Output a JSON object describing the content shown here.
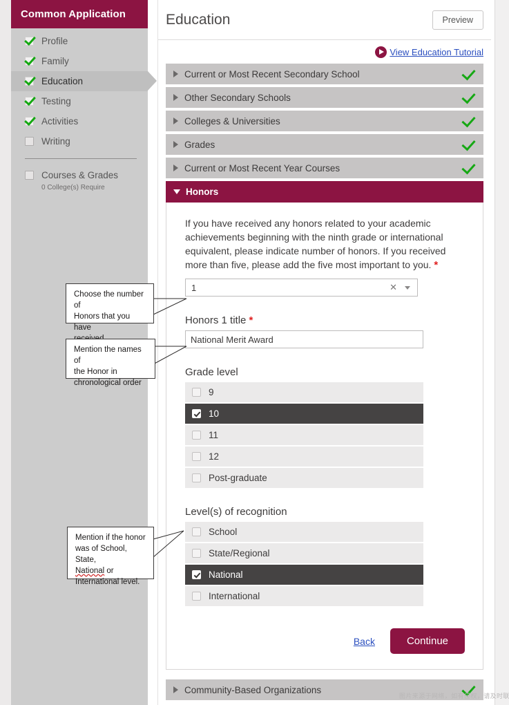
{
  "sidebar": {
    "title": "Common Application",
    "items": [
      {
        "label": "Profile",
        "checked": true,
        "active": false
      },
      {
        "label": "Family",
        "checked": true,
        "active": false
      },
      {
        "label": "Education",
        "checked": true,
        "active": true
      },
      {
        "label": "Testing",
        "checked": true,
        "active": false
      },
      {
        "label": "Activities",
        "checked": true,
        "active": false
      },
      {
        "label": "Writing",
        "checked": false,
        "active": false
      }
    ],
    "courses": {
      "label": "Courses & Grades",
      "sublabel": "0 College(s) Require",
      "checked": false
    }
  },
  "header": {
    "title": "Education",
    "preview_label": "Preview",
    "tutorial_link": "View Education Tutorial",
    "play_icon": "play-circle-icon"
  },
  "accordion": {
    "sections": [
      {
        "label": "Current or Most Recent Secondary School",
        "open": false,
        "complete": true
      },
      {
        "label": "Other Secondary Schools",
        "open": false,
        "complete": true
      },
      {
        "label": "Colleges & Universities",
        "open": false,
        "complete": true
      },
      {
        "label": "Grades",
        "open": false,
        "complete": true
      },
      {
        "label": "Current or Most Recent Year Courses",
        "open": false,
        "complete": true
      },
      {
        "label": "Honors",
        "open": true,
        "complete": false
      }
    ],
    "footer_section": {
      "label": "Community-Based Organizations",
      "open": false,
      "complete": true
    }
  },
  "honors": {
    "intro": "If you have received any honors related to your academic achievements beginning with the ninth grade or international equivalent, please indicate number of honors. If you received more than five, please add the five most important to you.",
    "required_marker": "*",
    "count_select": {
      "value": "1",
      "clear_icon": "clear-x-icon",
      "caret_icon": "chevron-down-icon"
    },
    "title_label": "Honors 1 title",
    "title_value": "National Merit Award",
    "title_placeholder": "",
    "grade_group_label": "Grade level",
    "grade_options": [
      {
        "label": "9",
        "selected": false
      },
      {
        "label": "10",
        "selected": true
      },
      {
        "label": "11",
        "selected": false
      },
      {
        "label": "12",
        "selected": false
      },
      {
        "label": "Post-graduate",
        "selected": false
      }
    ],
    "recognition_group_label": "Level(s) of recognition",
    "recognition_options": [
      {
        "label": "School",
        "selected": false
      },
      {
        "label": "State/Regional",
        "selected": false
      },
      {
        "label": "National",
        "selected": true
      },
      {
        "label": "International",
        "selected": false
      }
    ],
    "back_label": "Back",
    "continue_label": "Continue"
  },
  "callouts": [
    {
      "line1": "Choose the number of",
      "line2": "Honors that you have",
      "line3": "received",
      "misspelled": ""
    },
    {
      "line1": "Mention the names of",
      "line2": "the Honor in",
      "line3": "chronological order",
      "misspelled": ""
    },
    {
      "line1": "Mention if the honor",
      "line2": "was of School, State,",
      "line3_pre": "",
      "line3_spell": "National",
      "line3_post": " or",
      "line4": "International level."
    }
  ],
  "watermark": "图片来源于网络，如有侵权，请及时联系删除。",
  "colors": {
    "brand": "#8c1442",
    "sidebar_bg": "#cccccc",
    "accordion_bg": "#c6c4c4",
    "selected_row": "#454343",
    "check_green": "#16a814",
    "link_blue": "#2b4fbf",
    "required_red": "#e02020"
  }
}
